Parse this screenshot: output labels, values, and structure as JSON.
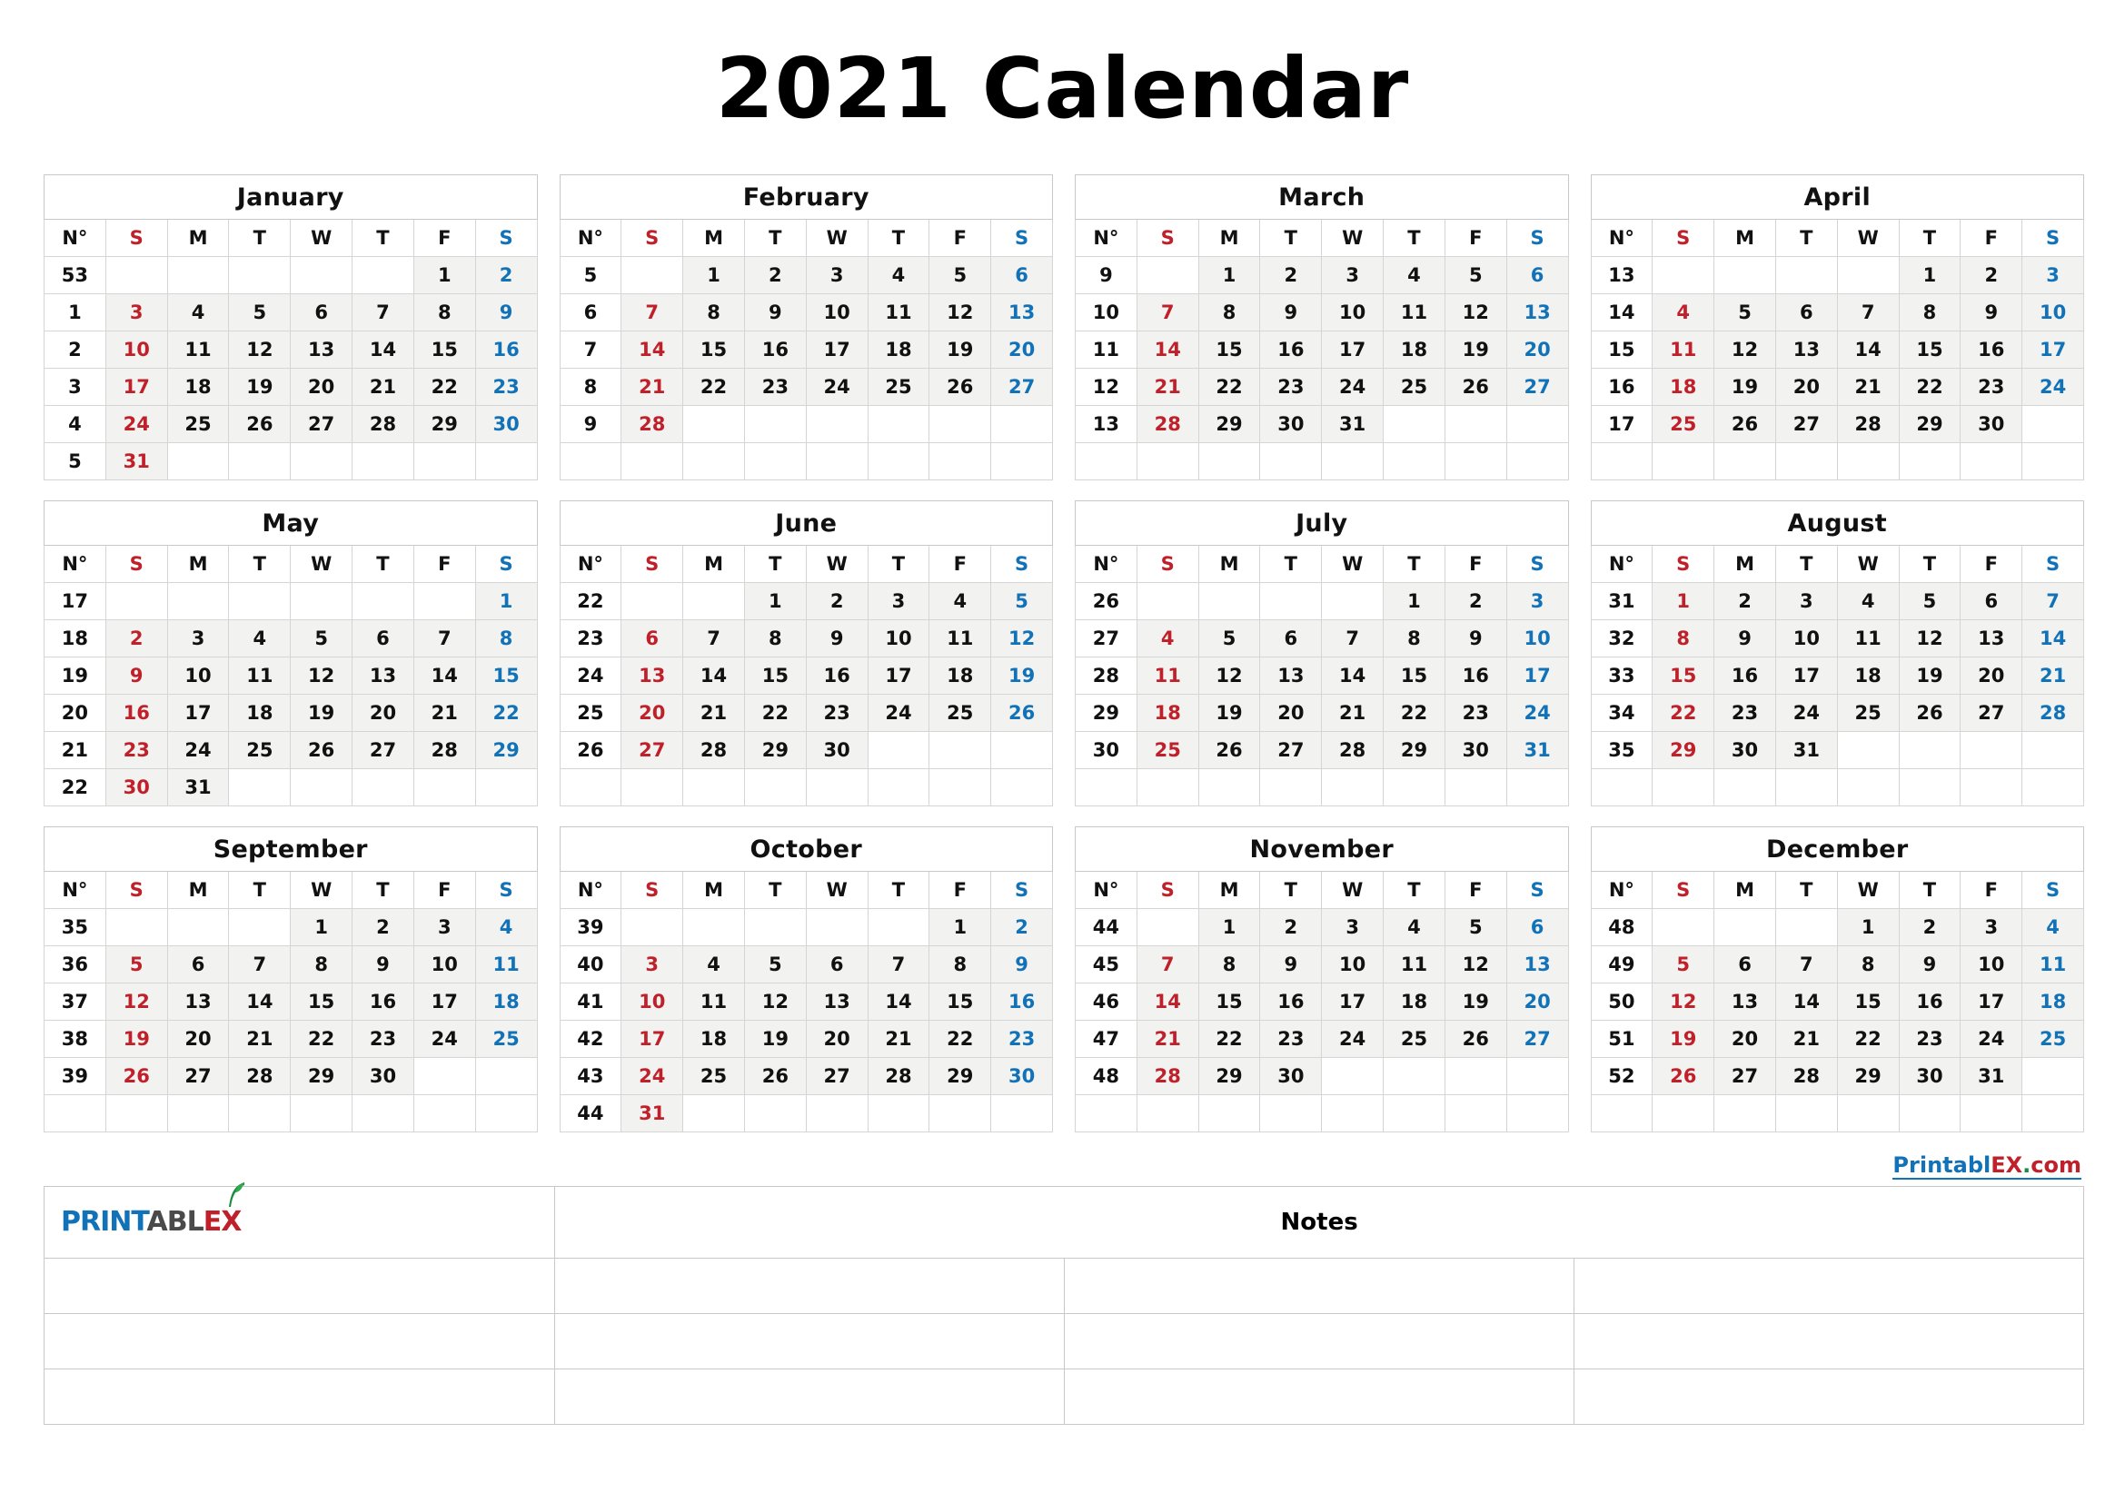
{
  "title": "2021 Calendar",
  "colors": {
    "sunday": "#c0202a",
    "saturday": "#1272b8",
    "weekday": "#111111",
    "cell_shade": "#f2f2f0",
    "grid": "#c8c8c8"
  },
  "week_number_header": "N°",
  "dow": [
    "S",
    "M",
    "T",
    "W",
    "T",
    "F",
    "S"
  ],
  "months": [
    {
      "name": "January",
      "weeks": [
        {
          "no": "53",
          "days": [
            "",
            "",
            "",
            "",
            "",
            "1",
            "2"
          ]
        },
        {
          "no": "1",
          "days": [
            "3",
            "4",
            "5",
            "6",
            "7",
            "8",
            "9"
          ]
        },
        {
          "no": "2",
          "days": [
            "10",
            "11",
            "12",
            "13",
            "14",
            "15",
            "16"
          ]
        },
        {
          "no": "3",
          "days": [
            "17",
            "18",
            "19",
            "20",
            "21",
            "22",
            "23"
          ]
        },
        {
          "no": "4",
          "days": [
            "24",
            "25",
            "26",
            "27",
            "28",
            "29",
            "30"
          ]
        },
        {
          "no": "5",
          "days": [
            "31",
            "",
            "",
            "",
            "",
            "",
            ""
          ]
        }
      ]
    },
    {
      "name": "February",
      "weeks": [
        {
          "no": "5",
          "days": [
            "",
            "1",
            "2",
            "3",
            "4",
            "5",
            "6"
          ]
        },
        {
          "no": "6",
          "days": [
            "7",
            "8",
            "9",
            "10",
            "11",
            "12",
            "13"
          ]
        },
        {
          "no": "7",
          "days": [
            "14",
            "15",
            "16",
            "17",
            "18",
            "19",
            "20"
          ]
        },
        {
          "no": "8",
          "days": [
            "21",
            "22",
            "23",
            "24",
            "25",
            "26",
            "27"
          ]
        },
        {
          "no": "9",
          "days": [
            "28",
            "",
            "",
            "",
            "",
            "",
            ""
          ]
        },
        {
          "no": "",
          "days": [
            "",
            "",
            "",
            "",
            "",
            "",
            ""
          ]
        }
      ]
    },
    {
      "name": "March",
      "weeks": [
        {
          "no": "9",
          "days": [
            "",
            "1",
            "2",
            "3",
            "4",
            "5",
            "6"
          ]
        },
        {
          "no": "10",
          "days": [
            "7",
            "8",
            "9",
            "10",
            "11",
            "12",
            "13"
          ]
        },
        {
          "no": "11",
          "days": [
            "14",
            "15",
            "16",
            "17",
            "18",
            "19",
            "20"
          ]
        },
        {
          "no": "12",
          "days": [
            "21",
            "22",
            "23",
            "24",
            "25",
            "26",
            "27"
          ]
        },
        {
          "no": "13",
          "days": [
            "28",
            "29",
            "30",
            "31",
            "",
            "",
            ""
          ]
        },
        {
          "no": "",
          "days": [
            "",
            "",
            "",
            "",
            "",
            "",
            ""
          ]
        }
      ]
    },
    {
      "name": "April",
      "weeks": [
        {
          "no": "13",
          "days": [
            "",
            "",
            "",
            "",
            "1",
            "2",
            "3"
          ]
        },
        {
          "no": "14",
          "days": [
            "4",
            "5",
            "6",
            "7",
            "8",
            "9",
            "10"
          ]
        },
        {
          "no": "15",
          "days": [
            "11",
            "12",
            "13",
            "14",
            "15",
            "16",
            "17"
          ]
        },
        {
          "no": "16",
          "days": [
            "18",
            "19",
            "20",
            "21",
            "22",
            "23",
            "24"
          ]
        },
        {
          "no": "17",
          "days": [
            "25",
            "26",
            "27",
            "28",
            "29",
            "30",
            ""
          ]
        },
        {
          "no": "",
          "days": [
            "",
            "",
            "",
            "",
            "",
            "",
            ""
          ]
        }
      ]
    },
    {
      "name": "May",
      "weeks": [
        {
          "no": "17",
          "days": [
            "",
            "",
            "",
            "",
            "",
            "",
            "1"
          ]
        },
        {
          "no": "18",
          "days": [
            "2",
            "3",
            "4",
            "5",
            "6",
            "7",
            "8"
          ]
        },
        {
          "no": "19",
          "days": [
            "9",
            "10",
            "11",
            "12",
            "13",
            "14",
            "15"
          ]
        },
        {
          "no": "20",
          "days": [
            "16",
            "17",
            "18",
            "19",
            "20",
            "21",
            "22"
          ]
        },
        {
          "no": "21",
          "days": [
            "23",
            "24",
            "25",
            "26",
            "27",
            "28",
            "29"
          ]
        },
        {
          "no": "22",
          "days": [
            "30",
            "31",
            "",
            "",
            "",
            "",
            ""
          ]
        }
      ]
    },
    {
      "name": "June",
      "weeks": [
        {
          "no": "22",
          "days": [
            "",
            "",
            "1",
            "2",
            "3",
            "4",
            "5"
          ]
        },
        {
          "no": "23",
          "days": [
            "6",
            "7",
            "8",
            "9",
            "10",
            "11",
            "12"
          ]
        },
        {
          "no": "24",
          "days": [
            "13",
            "14",
            "15",
            "16",
            "17",
            "18",
            "19"
          ]
        },
        {
          "no": "25",
          "days": [
            "20",
            "21",
            "22",
            "23",
            "24",
            "25",
            "26"
          ]
        },
        {
          "no": "26",
          "days": [
            "27",
            "28",
            "29",
            "30",
            "",
            "",
            ""
          ]
        },
        {
          "no": "",
          "days": [
            "",
            "",
            "",
            "",
            "",
            "",
            ""
          ]
        }
      ]
    },
    {
      "name": "July",
      "weeks": [
        {
          "no": "26",
          "days": [
            "",
            "",
            "",
            "",
            "1",
            "2",
            "3"
          ]
        },
        {
          "no": "27",
          "days": [
            "4",
            "5",
            "6",
            "7",
            "8",
            "9",
            "10"
          ]
        },
        {
          "no": "28",
          "days": [
            "11",
            "12",
            "13",
            "14",
            "15",
            "16",
            "17"
          ]
        },
        {
          "no": "29",
          "days": [
            "18",
            "19",
            "20",
            "21",
            "22",
            "23",
            "24"
          ]
        },
        {
          "no": "30",
          "days": [
            "25",
            "26",
            "27",
            "28",
            "29",
            "30",
            "31"
          ]
        },
        {
          "no": "",
          "days": [
            "",
            "",
            "",
            "",
            "",
            "",
            ""
          ]
        }
      ]
    },
    {
      "name": "August",
      "weeks": [
        {
          "no": "31",
          "days": [
            "1",
            "2",
            "3",
            "4",
            "5",
            "6",
            "7"
          ]
        },
        {
          "no": "32",
          "days": [
            "8",
            "9",
            "10",
            "11",
            "12",
            "13",
            "14"
          ]
        },
        {
          "no": "33",
          "days": [
            "15",
            "16",
            "17",
            "18",
            "19",
            "20",
            "21"
          ]
        },
        {
          "no": "34",
          "days": [
            "22",
            "23",
            "24",
            "25",
            "26",
            "27",
            "28"
          ]
        },
        {
          "no": "35",
          "days": [
            "29",
            "30",
            "31",
            "",
            "",
            "",
            ""
          ]
        },
        {
          "no": "",
          "days": [
            "",
            "",
            "",
            "",
            "",
            "",
            ""
          ]
        }
      ]
    },
    {
      "name": "September",
      "weeks": [
        {
          "no": "35",
          "days": [
            "",
            "",
            "",
            "1",
            "2",
            "3",
            "4"
          ]
        },
        {
          "no": "36",
          "days": [
            "5",
            "6",
            "7",
            "8",
            "9",
            "10",
            "11"
          ]
        },
        {
          "no": "37",
          "days": [
            "12",
            "13",
            "14",
            "15",
            "16",
            "17",
            "18"
          ]
        },
        {
          "no": "38",
          "days": [
            "19",
            "20",
            "21",
            "22",
            "23",
            "24",
            "25"
          ]
        },
        {
          "no": "39",
          "days": [
            "26",
            "27",
            "28",
            "29",
            "30",
            "",
            ""
          ]
        },
        {
          "no": "",
          "days": [
            "",
            "",
            "",
            "",
            "",
            "",
            ""
          ]
        }
      ]
    },
    {
      "name": "October",
      "weeks": [
        {
          "no": "39",
          "days": [
            "",
            "",
            "",
            "",
            "",
            "1",
            "2"
          ]
        },
        {
          "no": "40",
          "days": [
            "3",
            "4",
            "5",
            "6",
            "7",
            "8",
            "9"
          ]
        },
        {
          "no": "41",
          "days": [
            "10",
            "11",
            "12",
            "13",
            "14",
            "15",
            "16"
          ]
        },
        {
          "no": "42",
          "days": [
            "17",
            "18",
            "19",
            "20",
            "21",
            "22",
            "23"
          ]
        },
        {
          "no": "43",
          "days": [
            "24",
            "25",
            "26",
            "27",
            "28",
            "29",
            "30"
          ]
        },
        {
          "no": "44",
          "days": [
            "31",
            "",
            "",
            "",
            "",
            "",
            ""
          ]
        }
      ]
    },
    {
      "name": "November",
      "weeks": [
        {
          "no": "44",
          "days": [
            "",
            "1",
            "2",
            "3",
            "4",
            "5",
            "6"
          ]
        },
        {
          "no": "45",
          "days": [
            "7",
            "8",
            "9",
            "10",
            "11",
            "12",
            "13"
          ]
        },
        {
          "no": "46",
          "days": [
            "14",
            "15",
            "16",
            "17",
            "18",
            "19",
            "20"
          ]
        },
        {
          "no": "47",
          "days": [
            "21",
            "22",
            "23",
            "24",
            "25",
            "26",
            "27"
          ]
        },
        {
          "no": "48",
          "days": [
            "28",
            "29",
            "30",
            "",
            "",
            "",
            ""
          ]
        },
        {
          "no": "",
          "days": [
            "",
            "",
            "",
            "",
            "",
            "",
            ""
          ]
        }
      ]
    },
    {
      "name": "December",
      "weeks": [
        {
          "no": "48",
          "days": [
            "",
            "",
            "",
            "1",
            "2",
            "3",
            "4"
          ]
        },
        {
          "no": "49",
          "days": [
            "5",
            "6",
            "7",
            "8",
            "9",
            "10",
            "11"
          ]
        },
        {
          "no": "50",
          "days": [
            "12",
            "13",
            "14",
            "15",
            "16",
            "17",
            "18"
          ]
        },
        {
          "no": "51",
          "days": [
            "19",
            "20",
            "21",
            "22",
            "23",
            "24",
            "25"
          ]
        },
        {
          "no": "52",
          "days": [
            "26",
            "27",
            "28",
            "29",
            "30",
            "31",
            ""
          ]
        },
        {
          "no": "",
          "days": [
            "",
            "",
            "",
            "",
            "",
            "",
            ""
          ]
        }
      ]
    }
  ],
  "footer": {
    "brand_link": {
      "part1": "Printabl",
      "part2": "EX",
      "part3": ".",
      "part4": "com"
    },
    "logo": {
      "part1": "PRINT",
      "part2": "ABL",
      "part3": "EX",
      "leaf": "leaf-icon"
    },
    "notes_title": "Notes",
    "notes_rows": 3,
    "notes_cols": 4
  }
}
